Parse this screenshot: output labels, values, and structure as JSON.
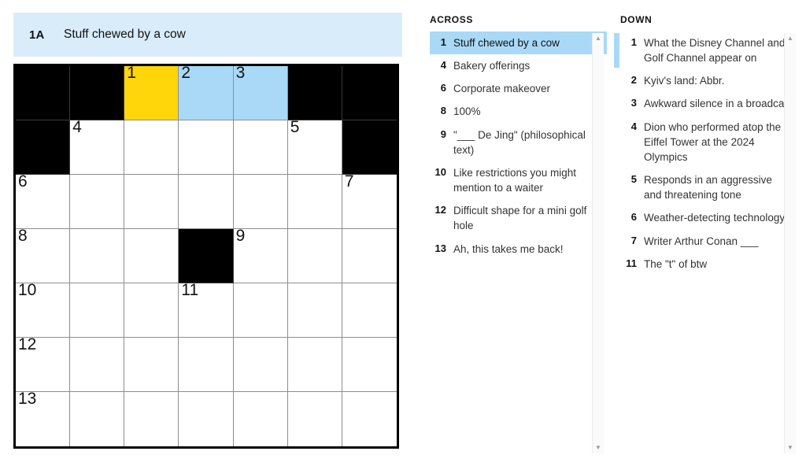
{
  "current_clue": {
    "number": "1A",
    "text": "Stuff chewed by a cow"
  },
  "colors": {
    "selected_cell": "#ffd60a",
    "highlighted_cell": "#a9d9f6",
    "banner_background": "#d9ecf9",
    "block_cell": "#000000"
  },
  "grid": {
    "rows": 7,
    "cols": 7,
    "cells": [
      [
        {
          "type": "block"
        },
        {
          "type": "block"
        },
        {
          "type": "open",
          "number": "1",
          "state": "selected",
          "letter": ""
        },
        {
          "type": "open",
          "number": "2",
          "state": "highlighted",
          "letter": ""
        },
        {
          "type": "open",
          "number": "3",
          "state": "highlighted",
          "letter": ""
        },
        {
          "type": "block"
        },
        {
          "type": "block"
        }
      ],
      [
        {
          "type": "block"
        },
        {
          "type": "open",
          "number": "4",
          "state": "normal",
          "letter": ""
        },
        {
          "type": "open",
          "number": "",
          "state": "normal",
          "letter": ""
        },
        {
          "type": "open",
          "number": "",
          "state": "normal",
          "letter": ""
        },
        {
          "type": "open",
          "number": "",
          "state": "normal",
          "letter": ""
        },
        {
          "type": "open",
          "number": "5",
          "state": "normal",
          "letter": ""
        },
        {
          "type": "block"
        }
      ],
      [
        {
          "type": "open",
          "number": "6",
          "state": "normal",
          "letter": ""
        },
        {
          "type": "open",
          "number": "",
          "state": "normal",
          "letter": ""
        },
        {
          "type": "open",
          "number": "",
          "state": "normal",
          "letter": ""
        },
        {
          "type": "open",
          "number": "",
          "state": "normal",
          "letter": ""
        },
        {
          "type": "open",
          "number": "",
          "state": "normal",
          "letter": ""
        },
        {
          "type": "open",
          "number": "",
          "state": "normal",
          "letter": ""
        },
        {
          "type": "open",
          "number": "7",
          "state": "normal",
          "letter": ""
        }
      ],
      [
        {
          "type": "open",
          "number": "8",
          "state": "normal",
          "letter": ""
        },
        {
          "type": "open",
          "number": "",
          "state": "normal",
          "letter": ""
        },
        {
          "type": "open",
          "number": "",
          "state": "normal",
          "letter": ""
        },
        {
          "type": "block"
        },
        {
          "type": "open",
          "number": "9",
          "state": "normal",
          "letter": ""
        },
        {
          "type": "open",
          "number": "",
          "state": "normal",
          "letter": ""
        },
        {
          "type": "open",
          "number": "",
          "state": "normal",
          "letter": ""
        }
      ],
      [
        {
          "type": "open",
          "number": "10",
          "state": "normal",
          "letter": ""
        },
        {
          "type": "open",
          "number": "",
          "state": "normal",
          "letter": ""
        },
        {
          "type": "open",
          "number": "",
          "state": "normal",
          "letter": ""
        },
        {
          "type": "open",
          "number": "11",
          "state": "normal",
          "letter": ""
        },
        {
          "type": "open",
          "number": "",
          "state": "normal",
          "letter": ""
        },
        {
          "type": "open",
          "number": "",
          "state": "normal",
          "letter": ""
        },
        {
          "type": "open",
          "number": "",
          "state": "normal",
          "letter": ""
        }
      ],
      [
        {
          "type": "open",
          "number": "12",
          "state": "normal",
          "letter": ""
        },
        {
          "type": "open",
          "number": "",
          "state": "normal",
          "letter": ""
        },
        {
          "type": "open",
          "number": "",
          "state": "normal",
          "letter": ""
        },
        {
          "type": "open",
          "number": "",
          "state": "normal",
          "letter": ""
        },
        {
          "type": "open",
          "number": "",
          "state": "normal",
          "letter": ""
        },
        {
          "type": "open",
          "number": "",
          "state": "normal",
          "letter": ""
        },
        {
          "type": "open",
          "number": "",
          "state": "normal",
          "letter": ""
        }
      ],
      [
        {
          "type": "open",
          "number": "13",
          "state": "normal",
          "letter": ""
        },
        {
          "type": "open",
          "number": "",
          "state": "normal",
          "letter": ""
        },
        {
          "type": "open",
          "number": "",
          "state": "normal",
          "letter": ""
        },
        {
          "type": "open",
          "number": "",
          "state": "normal",
          "letter": ""
        },
        {
          "type": "open",
          "number": "",
          "state": "normal",
          "letter": ""
        },
        {
          "type": "open",
          "number": "",
          "state": "normal",
          "letter": ""
        },
        {
          "type": "open",
          "number": "",
          "state": "normal",
          "letter": ""
        }
      ]
    ]
  },
  "across": {
    "heading": "ACROSS",
    "clues": [
      {
        "number": "1",
        "text": "Stuff chewed by a cow",
        "active": true
      },
      {
        "number": "4",
        "text": "Bakery offerings",
        "active": false
      },
      {
        "number": "6",
        "text": "Corporate makeover",
        "active": false
      },
      {
        "number": "8",
        "text": "100%",
        "active": false
      },
      {
        "number": "9",
        "text": "\"___ De Jing\" (philosophical text)",
        "active": false
      },
      {
        "number": "10",
        "text": "Like restrictions you might mention to a waiter",
        "active": false
      },
      {
        "number": "12",
        "text": "Difficult shape for a mini golf hole",
        "active": false
      },
      {
        "number": "13",
        "text": "Ah, this takes me back!",
        "active": false
      }
    ]
  },
  "down": {
    "heading": "DOWN",
    "clues": [
      {
        "number": "1",
        "text": "What the Disney Channel and Golf Channel appear on",
        "active": true
      },
      {
        "number": "2",
        "text": "Kyiv's land: Abbr.",
        "active": false
      },
      {
        "number": "3",
        "text": "Awkward silence in a broadcast",
        "active": false
      },
      {
        "number": "4",
        "text": "Dion who performed atop the Eiffel Tower at the 2024 Olympics",
        "active": false
      },
      {
        "number": "5",
        "text": "Responds in an aggressive and threatening tone",
        "active": false
      },
      {
        "number": "6",
        "text": "Weather-detecting technology",
        "active": false
      },
      {
        "number": "7",
        "text": "Writer Arthur Conan ___",
        "active": false
      },
      {
        "number": "11",
        "text": "The \"t\" of btw",
        "active": false
      }
    ]
  },
  "scrollbars": {
    "across": {
      "up_arrow": "▲",
      "down_arrow": "▼"
    },
    "down": {
      "up_arrow": "▲",
      "down_arrow": "▼"
    }
  }
}
